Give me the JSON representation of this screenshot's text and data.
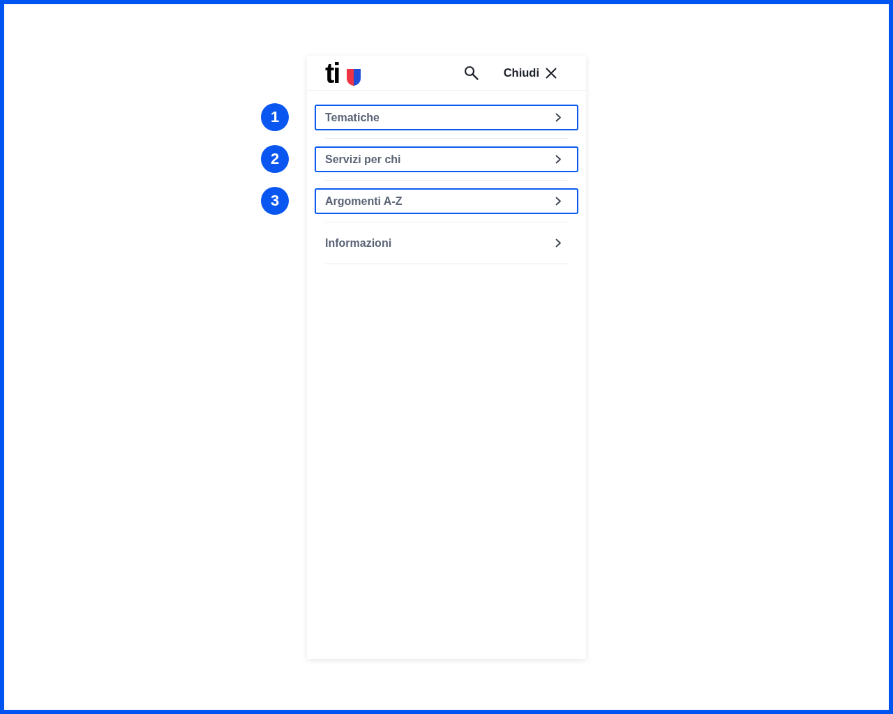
{
  "header": {
    "logo": "ti",
    "close_label": "Chiudi"
  },
  "menu": [
    {
      "label": "Tematiche",
      "highlighted": true,
      "callout": "1"
    },
    {
      "label": "Servizi per chi",
      "highlighted": true,
      "callout": "2"
    },
    {
      "label": "Argomenti A-Z",
      "highlighted": true,
      "callout": "3"
    },
    {
      "label": "Informazioni",
      "highlighted": false
    }
  ]
}
